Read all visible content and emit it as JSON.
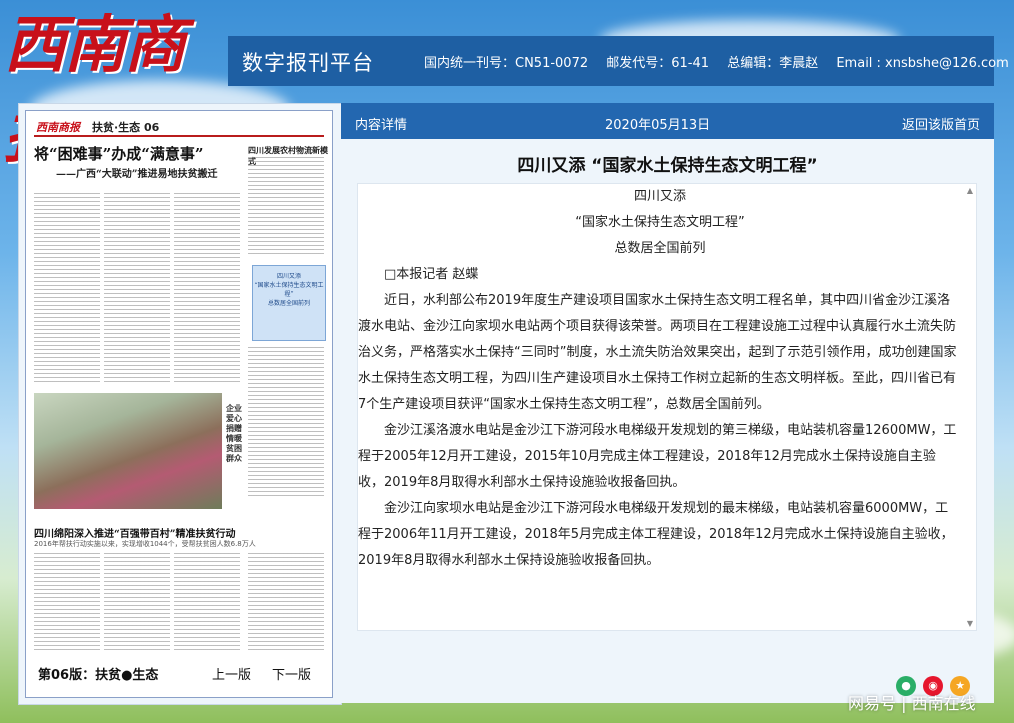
{
  "header": {
    "logo_text": "西南商报",
    "platform_title": "数字报刊平台",
    "cn_number": "国内统一刊号：CN51-0072",
    "postal_code": "邮发代号：61-41",
    "editor": "总编辑：李晨赵",
    "email": "Email : xnsbshe@126.com"
  },
  "newspaper": {
    "logo": "西南商报",
    "section": "扶贫·生态 06",
    "headline": "将“困难事”办成“满意事”",
    "subheadline": "——广西“大联动”推进易地扶贫搬迁",
    "right_title": "四川发展农村物流新模式",
    "highlight_lines": [
      "四川又添",
      "“国家水土保持生态文明工程”",
      "总数居全国前列"
    ],
    "photo_side_text": "企业爱心捐赠 情暖贫困群众",
    "bottom_headline": "四川绵阳深入推进“百强带百村”精准扶贫行动",
    "bottom_sub": "2016年帮扶行动实施以来，实现增收1044个，受帮扶贫困人数6.8万人",
    "footer": {
      "page_label": "第06版：扶贫●生态",
      "prev": "上一版",
      "next": "下一版"
    }
  },
  "detail": {
    "label": "内容详情",
    "date": "2020年05月13日",
    "back": "返回该版首页",
    "title": "四川又添 “国家水土保持生态文明工程”",
    "lines": {
      "l1": "四川又添",
      "l2": "“国家水土保持生态文明工程”",
      "l3": "总数居全国前列"
    },
    "reporter": "□本报记者 赵蝶",
    "paragraphs": {
      "p1": "近日，水利部公布2019年度生产建设项目国家水土保持生态文明工程名单，其中四川省金沙江溪洛渡水电站、金沙江向家坝水电站两个项目获得该荣誉。两项目在工程建设施工过程中认真履行水土流失防治义务，严格落实水土保持“三同时”制度，水土流失防治效果突出，起到了示范引领作用，成功创建国家水土保持生态文明工程，为四川生产建设项目水土保持工作树立起新的生态文明样板。至此，四川省已有7个生产建设项目获评“国家水土保持生态文明工程”，总数居全国前列。",
      "p2": "金沙江溪洛渡水电站是金沙江下游河段水电梯级开发规划的第三梯级，电站装机容量12600MW，工程于2005年12月开工建设，2015年10月完成主体工程建设，2018年12月完成水土保持设施自主验收，2019年8月取得水利部水土保持设施验收报备回执。",
      "p3": "金沙江向家坝水电站是金沙江下游河段水电梯级开发规划的最末梯级，电站装机容量6000MW，工程于2006年11月开工建设，2018年5月完成主体工程建设，2018年12月完成水土保持设施自主验收，2019年8月取得水利部水土保持设施验收报备回执。"
    }
  },
  "watermark": "网易号 | 西南在线"
}
